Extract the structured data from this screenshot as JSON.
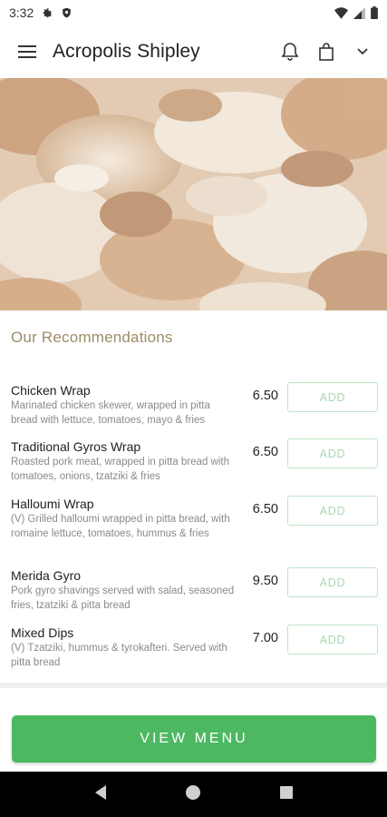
{
  "status_bar": {
    "time": "3:32",
    "icons": [
      "gear-icon",
      "shield-icon",
      "wifi-icon",
      "signal-icon",
      "battery-icon"
    ]
  },
  "app_bar": {
    "title": "Acropolis Shipley",
    "icons": [
      "hamburger-menu-icon",
      "bell-icon",
      "shopping-bag-icon",
      "chevron-down-icon"
    ]
  },
  "hero": {
    "image": "grilled gyros meat"
  },
  "recommendations": {
    "title": "Our Recommendations",
    "add_label": "ADD",
    "items": [
      {
        "name": "Chicken Wrap",
        "description": "Marinated chicken skewer, wrapped in pitta bread with lettuce, tomatoes, mayo & fries",
        "price": "6.50"
      },
      {
        "name": "Traditional Gyros Wrap",
        "description": "Roasted pork meat, wrapped in pitta bread with tomatoes, onions, tzatziki & fries",
        "price": "6.50"
      },
      {
        "name": "Halloumi Wrap",
        "description": "(V) Grilled halloumi wrapped in pitta bread, with romaine lettuce, tomatoes, hummus & fries",
        "price": "6.50"
      },
      {
        "name": "Merida Gyro",
        "description": "Pork gyro shavings served with salad, seasoned fries, tzatziki & pitta bread",
        "price": "9.50"
      },
      {
        "name": "Mixed Dips",
        "description": "(V) Tzatziki, hummus & tyrokafteri. Served with pitta bread",
        "price": "7.00"
      }
    ]
  },
  "cta": {
    "view_menu_label": "VIEW MENU"
  },
  "colors": {
    "accent_green": "#4cb861",
    "section_title": "#9c8c68",
    "add_border": "#bfe3c6"
  },
  "nav_bar": {
    "icons": [
      "back-icon",
      "home-icon",
      "recents-icon"
    ]
  }
}
